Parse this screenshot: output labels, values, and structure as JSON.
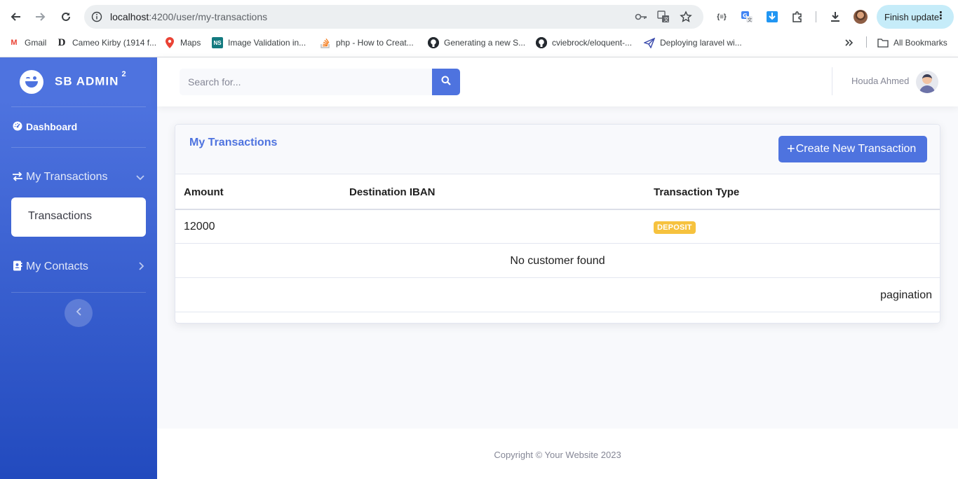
{
  "browser": {
    "url_host": "localhost",
    "url_path": ":4200/user/my-transactions",
    "finish_update_label": "Finish update",
    "bookmarks": [
      {
        "label": "Gmail",
        "icon": "gmail-icon"
      },
      {
        "label": "Cameo Kirby (1914 f...",
        "icon": "d-icon"
      },
      {
        "label": "Maps",
        "icon": "maps-icon"
      },
      {
        "label": "Image Validation in...",
        "icon": "ns-icon"
      },
      {
        "label": "php - How to Creat...",
        "icon": "stackoverflow-icon"
      },
      {
        "label": "Generating a new S...",
        "icon": "github-icon"
      },
      {
        "label": "cviebrock/eloquent-...",
        "icon": "github-icon"
      },
      {
        "label": "Deploying laravel wi...",
        "icon": "paper-plane-icon"
      }
    ],
    "all_bookmarks_label": "All Bookmarks"
  },
  "sidebar": {
    "brand": "SB ADMIN",
    "brand_sup": "2",
    "dashboard_label": "Dashboard",
    "transactions_group_label": "My Transactions",
    "transactions_item_label": "Transactions",
    "contacts_label": "My Contacts"
  },
  "topbar": {
    "search_placeholder": "Search for...",
    "user_name": "Houda Ahmed"
  },
  "card": {
    "title": "My Transactions",
    "create_button_label": "Create New Transaction",
    "columns": [
      "Amount",
      "Destination IBAN",
      "Transaction Type"
    ],
    "rows": [
      {
        "amount": "12000",
        "destination_iban": "",
        "transaction_type": "DEPOSIT"
      }
    ],
    "empty_message": "No customer found",
    "pagination_label": "pagination"
  },
  "footer": {
    "copyright": "Copyright © Your Website 2023"
  },
  "colors": {
    "primary": "#4e73df",
    "warning_badge": "#f6c23e",
    "sidebar_gradient_end": "#224abe"
  }
}
